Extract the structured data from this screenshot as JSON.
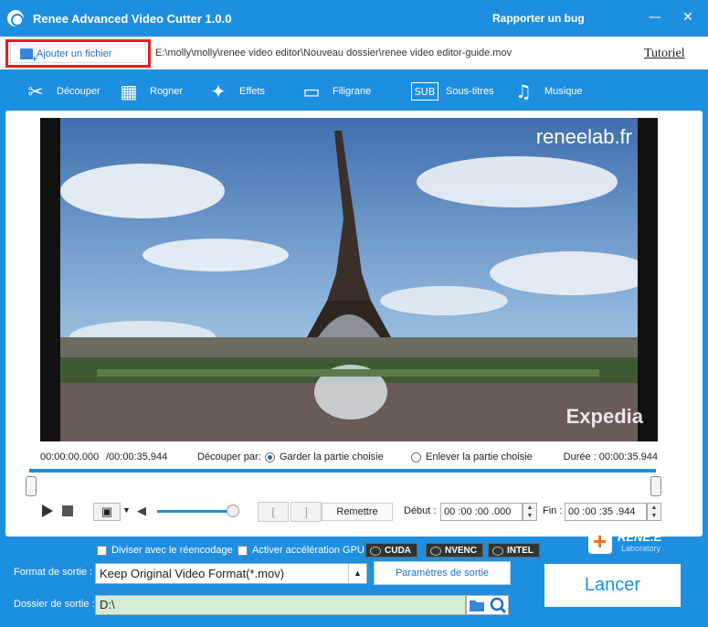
{
  "app": {
    "title": "Renee Advanced Video Cutter 1.0.0",
    "bug_link": "Rapporter un bug",
    "minimize_glyph": "—",
    "close_glyph": "✕"
  },
  "file": {
    "add_button": "Ajouter un fichier",
    "path": "E:\\molly\\molly\\renee video editor\\Nouveau dossier\\renee video editor-guide.mov",
    "tutorial": "Tutoriel"
  },
  "tabs": [
    {
      "label": "Découper",
      "icon": "scissors-film-icon",
      "active": true
    },
    {
      "label": "Rogner",
      "icon": "crop-film-icon",
      "active": false
    },
    {
      "label": "Effets",
      "icon": "magic-wand-icon",
      "active": false
    },
    {
      "label": "Filigrane",
      "icon": "watermark-icon",
      "active": false
    },
    {
      "label": "Sous-titres",
      "icon": "subtitle-icon",
      "active": false
    },
    {
      "label": "Musique",
      "icon": "music-note-icon",
      "active": false
    }
  ],
  "video": {
    "watermark": "reneelab.fr",
    "corner_brand": "Expedia"
  },
  "timeline": {
    "position": "00:00:00.000",
    "total": "/00:00:35.944",
    "cut_by_label": "Découper par:",
    "keep_option": "Garder la partie choisie",
    "remove_option": "Enlever la partie choisie",
    "duration": "Durée : 00:00:35.944",
    "volume_level": 0.9
  },
  "controls": {
    "reset": "Remettre",
    "start_label": "Début :",
    "start_value": "00 :00 :00 .000",
    "end_label": "Fin :",
    "end_value": "00 :00 :35 .944",
    "bracket_open": "[",
    "bracket_close": "]"
  },
  "options": {
    "split_reencode": "Diviser avec le réencodage",
    "gpu_accel": "Activer accélération GPU",
    "gpu_badges": [
      "CUDA",
      "NVENC",
      "INTEL"
    ]
  },
  "output": {
    "format_label": "Format de sortie :",
    "format_value": "Keep Original Video Format(*.mov)",
    "params_button": "Paramètres de sortie",
    "folder_label": "Dossier de sortie :",
    "folder_value": "D:\\",
    "launch_button": "Lancer"
  },
  "brand": {
    "name": "RENE.E",
    "sub": "Laboratory"
  },
  "colors": {
    "accent": "#1e8fe0",
    "highlight_border": "#e02020",
    "folder_field": "#d6ecd2"
  }
}
